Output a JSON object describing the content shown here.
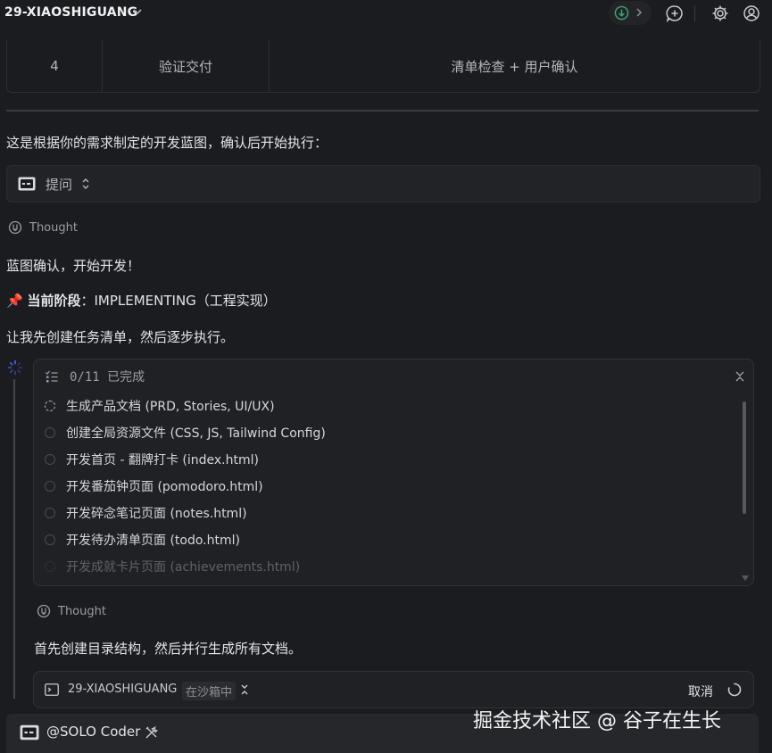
{
  "header": {
    "project_name": "29-XIAOSHIGUANG"
  },
  "table": {
    "row": {
      "num": "4",
      "stage": "验证交付",
      "content": "清单检查 + 用户确认"
    }
  },
  "messages": {
    "blueprint_text": "这是根据你的需求制定的开发蓝图，确认后开始执行：",
    "ask_label": "提问",
    "thought_label": "Thought",
    "confirm_text": "蓝图确认，开始开发！",
    "phase_emoji": "📌",
    "phase_bold": "当前阶段",
    "phase_value": "：IMPLEMENTING（工程实现）",
    "plan_text": "让我先创建任务清单，然后逐步执行。",
    "thought_label_2": "Thought",
    "next_text": "首先创建目录结构，然后并行生成所有文档。"
  },
  "tasks": {
    "progress": "0/11 已完成",
    "items": [
      {
        "label": "生成产品文档 (PRD, Stories, UI/UX)",
        "status": "in-progress"
      },
      {
        "label": "创建全局资源文件 (CSS, JS, Tailwind Config)",
        "status": "pending"
      },
      {
        "label": "开发首页 - 翻牌打卡 (index.html)",
        "status": "pending"
      },
      {
        "label": "开发番茄钟页面 (pomodoro.html)",
        "status": "pending"
      },
      {
        "label": "开发碎念笔记页面 (notes.html)",
        "status": "pending"
      },
      {
        "label": "开发待办清单页面 (todo.html)",
        "status": "pending"
      },
      {
        "label": "开发成就卡片页面 (achievements.html)",
        "status": "pending"
      }
    ]
  },
  "command": {
    "project": "29-XIAOSHIGUANG",
    "badge": "在沙箱中",
    "cancel_label": "取消"
  },
  "composer": {
    "agent_label": "@SOLO Coder"
  },
  "watermark": "掘金技术社区 @ 谷子在生长",
  "colors": {
    "background": "#1b1c1f",
    "panel": "#202125",
    "accent_blue": "#4a6cf7",
    "pin_red": "#e0384b",
    "status_green": "#3fa874"
  }
}
